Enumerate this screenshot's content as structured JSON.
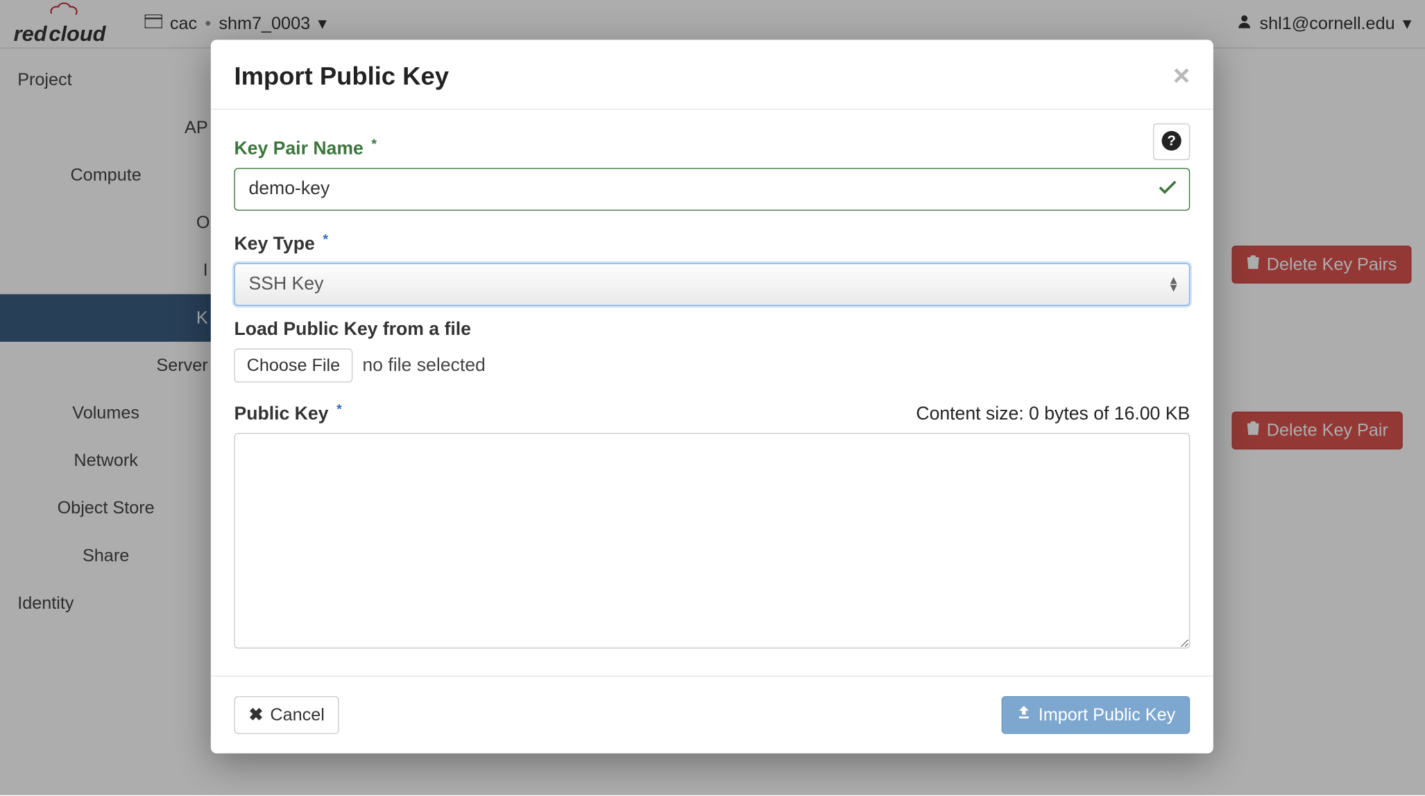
{
  "header": {
    "brand_left": "red",
    "brand_right": "cloud",
    "project_prefix": "cac",
    "project_name": "shm7_0003",
    "user": "shl1@cornell.edu"
  },
  "sidebar": {
    "items": [
      {
        "label": "Project"
      },
      {
        "label": "AP"
      },
      {
        "label": "Compute"
      },
      {
        "label": "O"
      },
      {
        "label": "I"
      },
      {
        "label": "K",
        "active": true
      },
      {
        "label": "Server"
      },
      {
        "label": "Volumes"
      },
      {
        "label": "Network"
      },
      {
        "label": "Object Store"
      },
      {
        "label": "Share"
      },
      {
        "label": "Identity"
      }
    ]
  },
  "bg_actions": {
    "delete_pairs": "Delete Key Pairs",
    "delete_pair": "Delete Key Pair"
  },
  "modal": {
    "title": "Import Public Key",
    "labels": {
      "key_pair_name": "Key Pair Name",
      "key_type": "Key Type",
      "load_from_file": "Load Public Key from a file",
      "public_key": "Public Key"
    },
    "fields": {
      "key_pair_name_value": "demo-key",
      "key_type_selected": "SSH Key",
      "file_button": "Choose File",
      "file_status": "no file selected",
      "public_key_value": ""
    },
    "content_size_text": "Content size: 0 bytes of 16.00 KB",
    "buttons": {
      "cancel": "Cancel",
      "submit": "Import Public Key"
    }
  }
}
